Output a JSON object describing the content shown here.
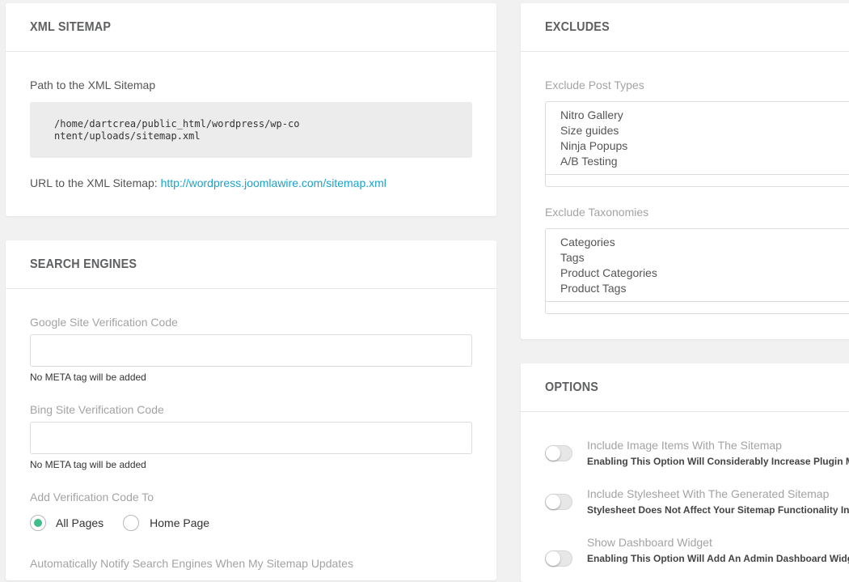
{
  "xml_sitemap": {
    "title": "XML SITEMAP",
    "path_label": "Path to the XML Sitemap",
    "path_value": "/home/dartcrea/public_html/wordpress/wp-content/uploads/sitemap.xml",
    "url_label": "URL to the XML Sitemap: ",
    "url_value": "http://wordpress.joomlawire.com/sitemap.xml"
  },
  "search_engines": {
    "title": "SEARCH ENGINES",
    "google_label": "Google Site Verification Code",
    "google_value": "",
    "google_hint": "No META tag will be added",
    "bing_label": "Bing Site Verification Code",
    "bing_value": "",
    "bing_hint": "No META tag will be added",
    "add_to_label": "Add Verification Code To",
    "add_to_options": [
      {
        "label": "All Pages",
        "checked": true
      },
      {
        "label": "Home Page",
        "checked": false
      }
    ],
    "notify_label": "Automatically Notify Search Engines When My Sitemap Updates"
  },
  "excludes": {
    "title": "EXCLUDES",
    "post_types_label": "Exclude Post Types",
    "post_types": [
      "Nitro Gallery",
      "Size guides",
      "Ninja Popups",
      "A/B Testing"
    ],
    "taxonomies_label": "Exclude Taxonomies",
    "taxonomies": [
      "Categories",
      "Tags",
      "Product Categories",
      "Product Tags"
    ]
  },
  "options": {
    "title": "OPTIONS",
    "items": [
      {
        "title": "Include Image Items With The Sitemap",
        "desc": "Enabling This Option Will Considerably Increase Plugin Me",
        "enabled": false
      },
      {
        "title": "Include Stylesheet With The Generated Sitemap",
        "desc": "Stylesheet Does Not Affect Your Sitemap Functionality In A",
        "enabled": false
      },
      {
        "title": "Show Dashboard Widget",
        "desc": "Enabling This Option Will Add An Admin Dashboard Widge",
        "enabled": false
      }
    ]
  },
  "colors": {
    "accent": "#3fbe8a",
    "link": "#1ba3c7",
    "background": "#f1f1f1"
  }
}
